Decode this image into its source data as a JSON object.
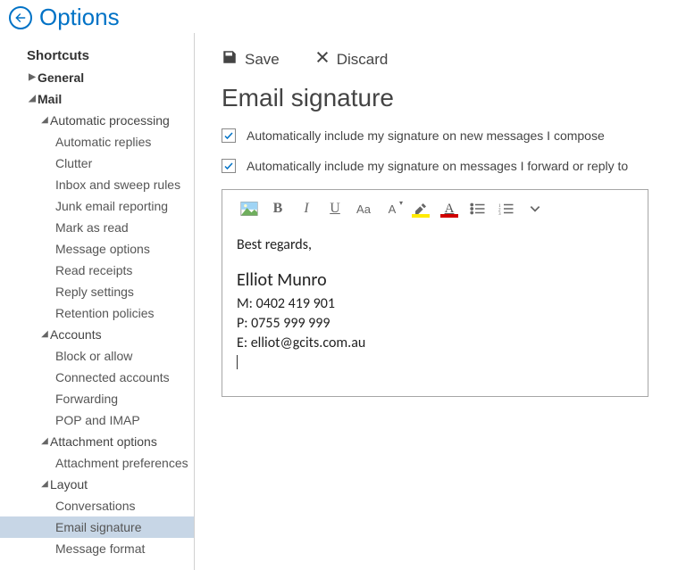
{
  "header": {
    "title": "Options"
  },
  "sidebar": {
    "shortcuts": "Shortcuts",
    "general": "General",
    "mail": "Mail",
    "autoproc": {
      "label": "Automatic processing",
      "items": [
        "Automatic replies",
        "Clutter",
        "Inbox and sweep rules",
        "Junk email reporting",
        "Mark as read",
        "Message options",
        "Read receipts",
        "Reply settings",
        "Retention policies"
      ]
    },
    "accounts": {
      "label": "Accounts",
      "items": [
        "Block or allow",
        "Connected accounts",
        "Forwarding",
        "POP and IMAP"
      ]
    },
    "attach": {
      "label": "Attachment options",
      "items": [
        "Attachment preferences"
      ]
    },
    "layout": {
      "label": "Layout",
      "items": [
        "Conversations",
        "Email signature",
        "Message format"
      ]
    }
  },
  "actions": {
    "save": "Save",
    "discard": "Discard"
  },
  "page": {
    "title": "Email signature",
    "check_compose": "Automatically include my signature on new messages I compose",
    "check_reply": "Automatically include my signature on messages I forward or reply to"
  },
  "signature": {
    "greeting": "Best regards,",
    "name": "Elliot Munro",
    "mobile_label": "M:",
    "mobile": "0402 419 901",
    "phone_label": "P:",
    "phone": "0755 999 999",
    "email_label": "E:",
    "email": "elliot@gcits.com.au"
  }
}
